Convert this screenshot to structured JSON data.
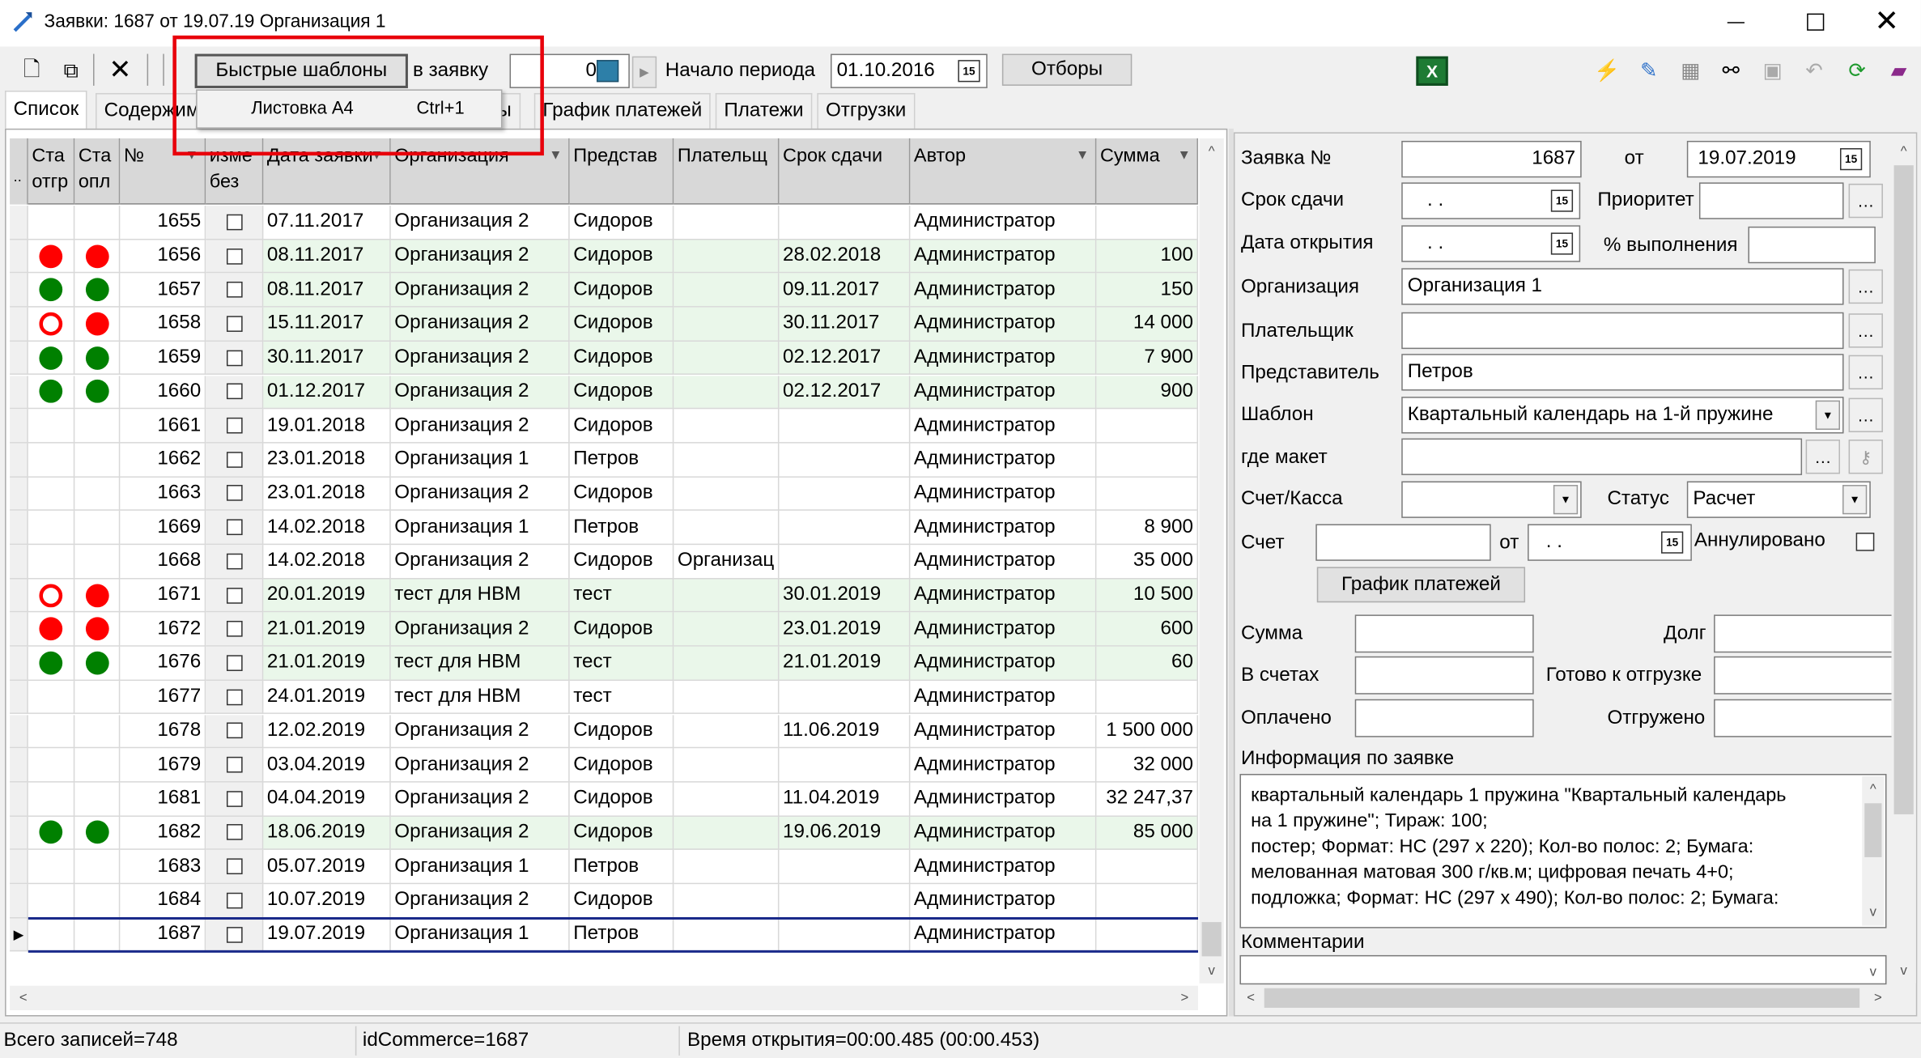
{
  "window": {
    "title": "Заявки: 1687 от 19.07.19  Организация 1"
  },
  "toolbar": {
    "quick_templates": "Быстрые шаблоны",
    "to_order": "в заявку",
    "counter": "0",
    "period_start_label": "Начало периода",
    "period_start": "01.10.2016",
    "filters": "Отборы"
  },
  "menu": {
    "item": "Листовка А4",
    "shortcut": "Ctrl+1"
  },
  "tabs": [
    "Список",
    "Содержим",
    "ы",
    "График платежей",
    "Платежи",
    "Отгрузки"
  ],
  "grid": {
    "headers": [
      "Ста отгр",
      "Ста опл",
      "№",
      "изме без",
      "Дата заявки",
      "Организация",
      "Представ",
      "Плательщ",
      "Срок сдачи",
      "Автор",
      "Сумма"
    ],
    "rows": [
      {
        "s1": "",
        "s2": "",
        "n": "1655",
        "date": "07.11.2017",
        "org": "Организация 2",
        "rep": "Сидоров",
        "payer": "",
        "due": "",
        "author": "Администратор",
        "sum": "",
        "hl": false
      },
      {
        "s1": "red",
        "s2": "red",
        "n": "1656",
        "date": "08.11.2017",
        "org": "Организация 2",
        "rep": "Сидоров",
        "payer": "",
        "due": "28.02.2018",
        "author": "Администратор",
        "sum": "100",
        "hl": true
      },
      {
        "s1": "green",
        "s2": "green",
        "n": "1657",
        "date": "08.11.2017",
        "org": "Организация 2",
        "rep": "Сидоров",
        "payer": "",
        "due": "09.11.2017",
        "author": "Администратор",
        "sum": "150",
        "hl": true
      },
      {
        "s1": "red-ring",
        "s2": "red",
        "n": "1658",
        "date": "15.11.2017",
        "org": "Организация 2",
        "rep": "Сидоров",
        "payer": "",
        "due": "30.11.2017",
        "author": "Администратор",
        "sum": "14 000",
        "hl": true
      },
      {
        "s1": "green",
        "s2": "green",
        "n": "1659",
        "date": "30.11.2017",
        "org": "Организация 2",
        "rep": "Сидоров",
        "payer": "",
        "due": "02.12.2017",
        "author": "Администратор",
        "sum": "7 900",
        "hl": true
      },
      {
        "s1": "green",
        "s2": "green",
        "n": "1660",
        "date": "01.12.2017",
        "org": "Организация 2",
        "rep": "Сидоров",
        "payer": "",
        "due": "02.12.2017",
        "author": "Администратор",
        "sum": "900",
        "hl": true
      },
      {
        "s1": "",
        "s2": "",
        "n": "1661",
        "date": "19.01.2018",
        "org": "Организация 2",
        "rep": "Сидоров",
        "payer": "",
        "due": "",
        "author": "Администратор",
        "sum": "",
        "hl": false
      },
      {
        "s1": "",
        "s2": "",
        "n": "1662",
        "date": "23.01.2018",
        "org": "Организация 1",
        "rep": "Петров",
        "payer": "",
        "due": "",
        "author": "Администратор",
        "sum": "",
        "hl": false
      },
      {
        "s1": "",
        "s2": "",
        "n": "1663",
        "date": "23.01.2018",
        "org": "Организация 2",
        "rep": "Сидоров",
        "payer": "",
        "due": "",
        "author": "Администратор",
        "sum": "",
        "hl": false
      },
      {
        "s1": "",
        "s2": "",
        "n": "1669",
        "date": "14.02.2018",
        "org": "Организация 1",
        "rep": "Петров",
        "payer": "",
        "due": "",
        "author": "Администратор",
        "sum": "8 900",
        "hl": false
      },
      {
        "s1": "",
        "s2": "",
        "n": "1668",
        "date": "14.02.2018",
        "org": "Организация 2",
        "rep": "Сидоров",
        "payer": "Организац",
        "due": "",
        "author": "Администратор",
        "sum": "35 000",
        "hl": false
      },
      {
        "s1": "red-ring",
        "s2": "red",
        "n": "1671",
        "date": "20.01.2019",
        "org": "тест для НВМ",
        "rep": "тест",
        "payer": "",
        "due": "30.01.2019",
        "author": "Администратор",
        "sum": "10 500",
        "hl": true
      },
      {
        "s1": "red",
        "s2": "red",
        "n": "1672",
        "date": "21.01.2019",
        "org": "Организация 2",
        "rep": "Сидоров",
        "payer": "",
        "due": "23.01.2019",
        "author": "Администратор",
        "sum": "600",
        "hl": true
      },
      {
        "s1": "green",
        "s2": "green",
        "n": "1676",
        "date": "21.01.2019",
        "org": "тест для НВМ",
        "rep": "тест",
        "payer": "",
        "due": "21.01.2019",
        "author": "Администратор",
        "sum": "60",
        "hl": true
      },
      {
        "s1": "",
        "s2": "",
        "n": "1677",
        "date": "24.01.2019",
        "org": "тест для НВМ",
        "rep": "тест",
        "payer": "",
        "due": "",
        "author": "Администратор",
        "sum": "",
        "hl": false
      },
      {
        "s1": "",
        "s2": "",
        "n": "1678",
        "date": "12.02.2019",
        "org": "Организация 2",
        "rep": "Сидоров",
        "payer": "",
        "due": "11.06.2019",
        "author": "Администратор",
        "sum": "1 500 000",
        "hl": false
      },
      {
        "s1": "",
        "s2": "",
        "n": "1679",
        "date": "03.04.2019",
        "org": "Организация 2",
        "rep": "Сидоров",
        "payer": "",
        "due": "",
        "author": "Администратор",
        "sum": "32 000",
        "hl": false
      },
      {
        "s1": "",
        "s2": "",
        "n": "1681",
        "date": "04.04.2019",
        "org": "Организация 2",
        "rep": "Сидоров",
        "payer": "",
        "due": "11.04.2019",
        "author": "Администратор",
        "sum": "32 247,37",
        "hl": false
      },
      {
        "s1": "green",
        "s2": "green",
        "n": "1682",
        "date": "18.06.2019",
        "org": "Организация 2",
        "rep": "Сидоров",
        "payer": "",
        "due": "19.06.2019",
        "author": "Администратор",
        "sum": "85 000",
        "hl": true
      },
      {
        "s1": "",
        "s2": "",
        "n": "1683",
        "date": "05.07.2019",
        "org": "Организация 1",
        "rep": "Петров",
        "payer": "",
        "due": "",
        "author": "Администратор",
        "sum": "",
        "hl": false
      },
      {
        "s1": "",
        "s2": "",
        "n": "1684",
        "date": "10.07.2019",
        "org": "Организация 2",
        "rep": "Сидоров",
        "payer": "",
        "due": "",
        "author": "Администратор",
        "sum": "",
        "hl": false
      },
      {
        "s1": "",
        "s2": "",
        "n": "1687",
        "date": "19.07.2019",
        "org": "Организация 1",
        "rep": "Петров",
        "payer": "",
        "due": "",
        "author": "Администратор",
        "sum": "",
        "hl": false,
        "current": true
      }
    ]
  },
  "form": {
    "order_no_label": "Заявка №",
    "order_no": "1687",
    "from_label": "от",
    "from_date": "19.07.2019",
    "due_label": "Срок сдачи",
    "due_value": "  .  .",
    "priority_label": "Приоритет",
    "open_date_label": "Дата открытия",
    "open_date_value": "  .  .",
    "percent_label": "% выполнения",
    "org_label": "Организация",
    "org_value": "Организация 1",
    "payer_label": "Плательщик",
    "rep_label": "Представитель",
    "rep_value": "Петров",
    "template_label": "Шаблон",
    "template_value": "Квартальный календарь на 1-й пружине",
    "layout_label": "где макет",
    "account_label": "Счет/Касса",
    "status_label": "Статус",
    "status_value": "Расчет",
    "invoice_label": "Счет",
    "invoice_from": "от",
    "invoice_date": "  .  .",
    "cancelled_label": "Аннулировано",
    "payment_schedule": "График платежей",
    "sum_label": "Сумма",
    "debt_label": "Долг",
    "in_invoices_label": "В счетах",
    "ready_label": "Готово к отгрузке",
    "paid_label": "Оплачено",
    "shipped_label": "Отгружено",
    "info_label": "Информация по заявке",
    "info_text": [
      "квартальный календарь 1 пружина \"Квартальный календарь",
      "на 1 пружине\"; Тираж: 100;",
      "постер; Формат: НС (297 х 220); Кол-во полос: 2;  Бумага:",
      "мелованная матовая 300 г/кв.м; цифровая печать 4+0;",
      "подложка; Формат: НС (297 х 490); Кол-во полос: 2;  Бумага:"
    ],
    "comments_label": "Комментарии"
  },
  "status": {
    "records": "Всего записей=748",
    "id": "idCommerce=1687",
    "time": "Время открытия=00:00.485 (00:00.453)"
  },
  "colors": {
    "green": "#008000",
    "red": "#ff0000",
    "highlight": "#eaf7ea",
    "annotation": "#e8000b"
  }
}
